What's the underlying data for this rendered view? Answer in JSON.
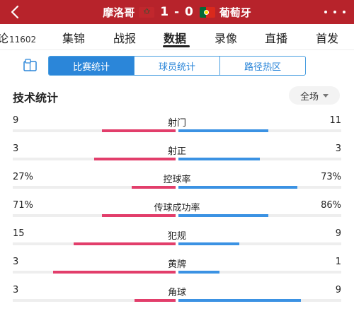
{
  "header": {
    "home_team": "摩洛哥",
    "score": "1 - 0",
    "away_team": "葡萄牙"
  },
  "nav": {
    "comment_label": "论",
    "comment_count": "11602",
    "items": [
      "集锦",
      "战报",
      "数据",
      "录像",
      "直播",
      "首发"
    ],
    "active": "数据"
  },
  "subtabs": {
    "items": [
      "比赛统计",
      "球员统计",
      "路径热区"
    ],
    "active": "比赛统计"
  },
  "section": {
    "title": "技术统计",
    "filter": "全场"
  },
  "colors": {
    "header_bg": "#b7232b",
    "home_bar": "#e23e6b",
    "away_bar": "#3b92e3",
    "accent": "#2b86d9"
  },
  "stats": [
    {
      "label": "射门",
      "left": "9",
      "right": "11",
      "left_frac": 0.45,
      "right_frac": 0.55
    },
    {
      "label": "射正",
      "left": "3",
      "right": "3",
      "left_frac": 0.5,
      "right_frac": 0.5
    },
    {
      "label": "控球率",
      "left": "27%",
      "right": "73%",
      "left_frac": 0.27,
      "right_frac": 0.73
    },
    {
      "label": "传球成功率",
      "left": "71%",
      "right": "86%",
      "left_frac": 0.45,
      "right_frac": 0.55
    },
    {
      "label": "犯规",
      "left": "15",
      "right": "9",
      "left_frac": 0.625,
      "right_frac": 0.375
    },
    {
      "label": "黄牌",
      "left": "3",
      "right": "1",
      "left_frac": 0.75,
      "right_frac": 0.25
    },
    {
      "label": "角球",
      "left": "3",
      "right": "9",
      "left_frac": 0.25,
      "right_frac": 0.75
    }
  ]
}
